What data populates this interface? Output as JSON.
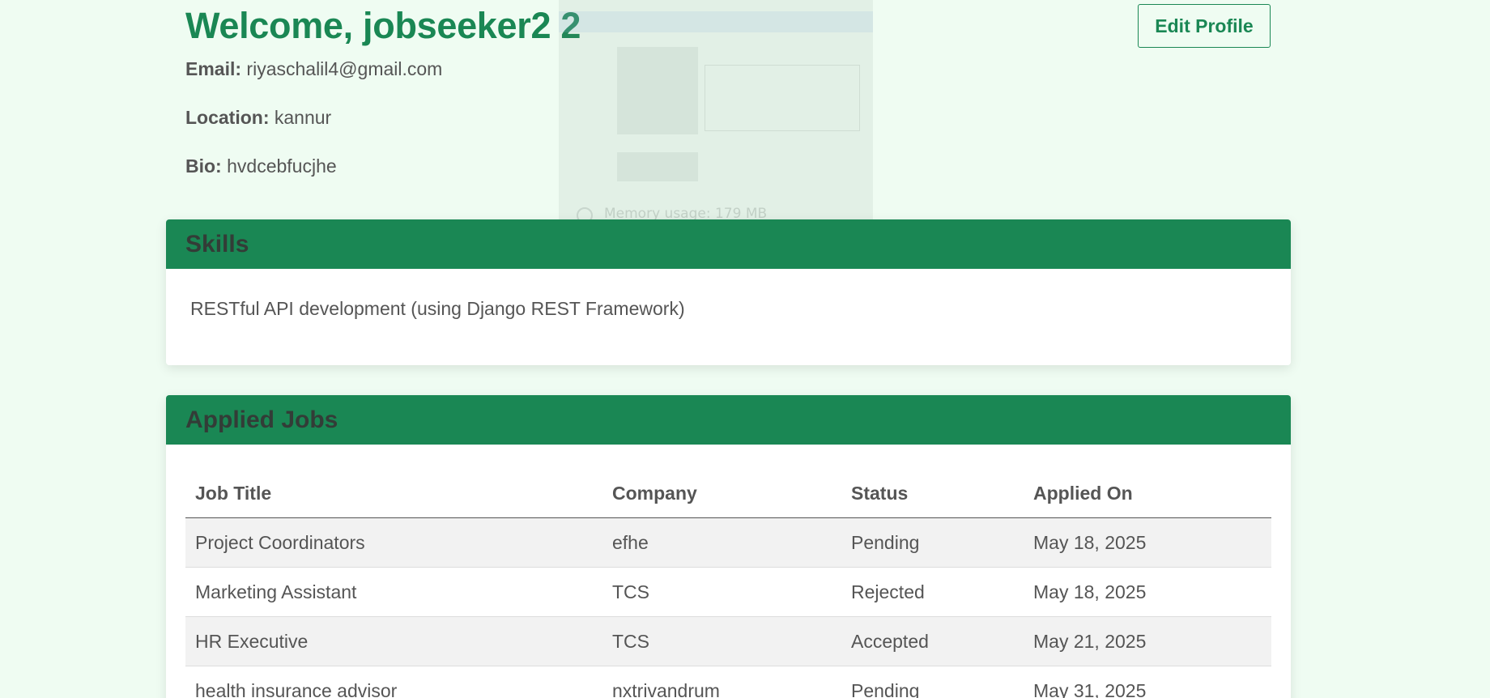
{
  "profile": {
    "welcome": "Welcome, jobseeker2 2",
    "edit_button": "Edit Profile",
    "email_label": "Email:",
    "email": "riyaschalil4@gmail.com",
    "location_label": "Location:",
    "location": "kannur",
    "bio_label": "Bio:",
    "bio": "hvdcebfucjhe"
  },
  "overlay": {
    "memory_text": "Memory usage: 179 MB"
  },
  "skills": {
    "title": "Skills",
    "text": "RESTful API development (using Django REST Framework)"
  },
  "applied_jobs": {
    "title": "Applied Jobs",
    "columns": [
      "Job Title",
      "Company",
      "Status",
      "Applied On"
    ],
    "rows": [
      {
        "title": "Project Coordinators",
        "company": "efhe",
        "status": "Pending",
        "date": "May 18, 2025"
      },
      {
        "title": "Marketing Assistant",
        "company": "TCS",
        "status": "Rejected",
        "date": "May 18, 2025"
      },
      {
        "title": "HR Executive",
        "company": "TCS",
        "status": "Accepted",
        "date": "May 21, 2025"
      },
      {
        "title": "health insurance advisor",
        "company": "nxtrivandrum",
        "status": "Pending",
        "date": "May 31, 2025"
      }
    ]
  },
  "colors": {
    "accent": "#1a8754",
    "background": "#effcf2",
    "header_text": "#333c37"
  }
}
